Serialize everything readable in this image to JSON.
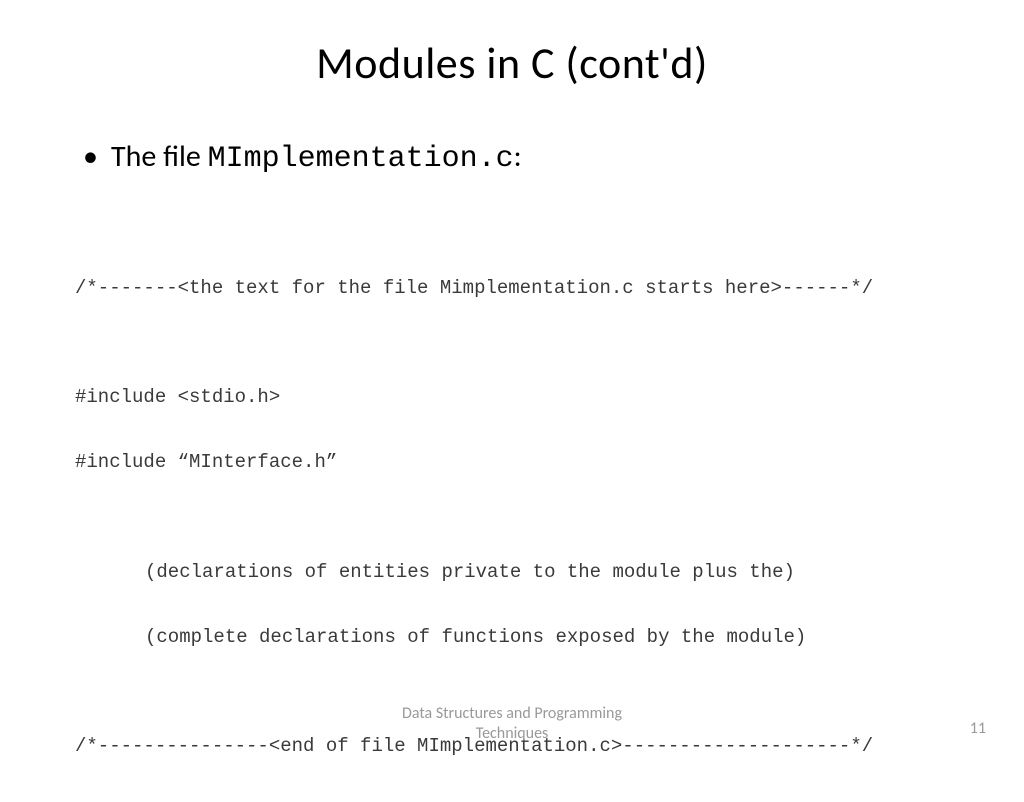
{
  "title": "Modules in C (cont'd)",
  "bullet": {
    "prefix": "The file ",
    "filename": "MImplementation.c",
    "suffix": ":"
  },
  "code": {
    "line1": "/*-------<the text for the file Mimplementation.c starts here>------*/",
    "line2": "",
    "line3": "#include <stdio.h>",
    "line4": "#include “MInterface.h”",
    "line5": "",
    "line6": "(declarations of entities private to the module plus the)",
    "line7": "(complete declarations of functions exposed by the module)",
    "line8": "",
    "line9": "/*---------------<end of file MImplementation.c>--------------------*/"
  },
  "footer": {
    "line1": "Data Structures and Programming",
    "line2": "Techniques"
  },
  "pageNumber": "11"
}
